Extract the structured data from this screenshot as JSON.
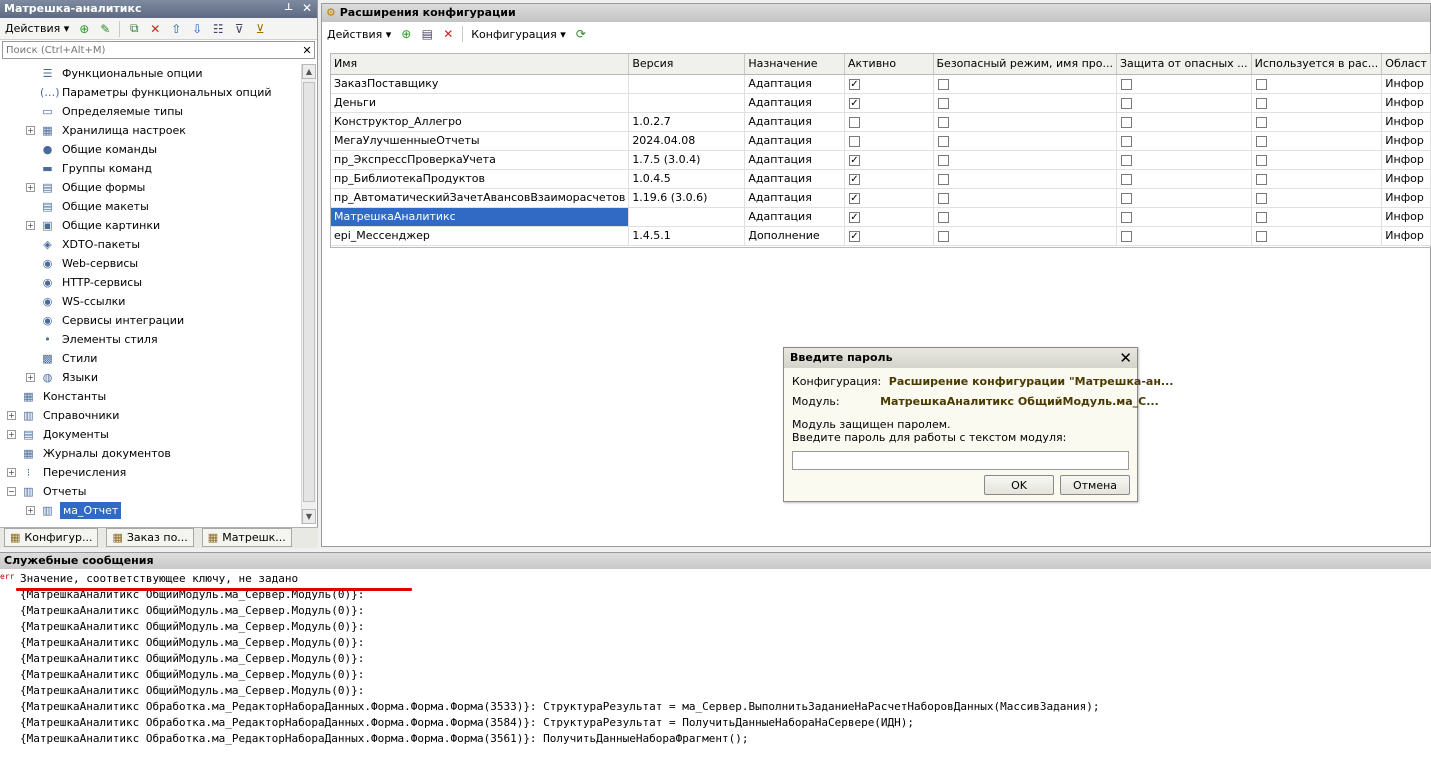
{
  "left_panel": {
    "title": "Матрешка-аналитикс",
    "actions_label": "Действия",
    "search_placeholder": "Поиск (Ctrl+Alt+M)",
    "tree": [
      {
        "label": "Функциональные опции",
        "indent": 2,
        "expander": false,
        "icon": "functional-options-icon",
        "glyph": "☰"
      },
      {
        "label": "Параметры функциональных опций",
        "indent": 2,
        "expander": false,
        "icon": "fo-params-icon",
        "glyph": "(…)"
      },
      {
        "label": "Определяемые типы",
        "indent": 2,
        "expander": false,
        "icon": "defined-types-icon",
        "glyph": "▭"
      },
      {
        "label": "Хранилища настроек",
        "indent": 2,
        "expander": true,
        "icon": "settings-storage-icon",
        "glyph": "▦"
      },
      {
        "label": "Общие команды",
        "indent": 2,
        "expander": false,
        "icon": "common-commands-icon",
        "glyph": "●"
      },
      {
        "label": "Группы команд",
        "indent": 2,
        "expander": false,
        "icon": "command-groups-icon",
        "glyph": "▬"
      },
      {
        "label": "Общие формы",
        "indent": 2,
        "expander": true,
        "icon": "common-forms-icon",
        "glyph": "▤"
      },
      {
        "label": "Общие макеты",
        "indent": 2,
        "expander": false,
        "icon": "common-templates-icon",
        "glyph": "▤"
      },
      {
        "label": "Общие картинки",
        "indent": 2,
        "expander": true,
        "icon": "common-pictures-icon",
        "glyph": "▣"
      },
      {
        "label": "XDTO-пакеты",
        "indent": 2,
        "expander": false,
        "icon": "xdto-icon",
        "glyph": "◈"
      },
      {
        "label": "Web-сервисы",
        "indent": 2,
        "expander": false,
        "icon": "web-services-icon",
        "glyph": "◉"
      },
      {
        "label": "HTTP-сервисы",
        "indent": 2,
        "expander": false,
        "icon": "http-services-icon",
        "glyph": "◉"
      },
      {
        "label": "WS-ссылки",
        "indent": 2,
        "expander": false,
        "icon": "ws-links-icon",
        "glyph": "◉"
      },
      {
        "label": "Сервисы интеграции",
        "indent": 2,
        "expander": false,
        "icon": "integration-services-icon",
        "glyph": "◉"
      },
      {
        "label": "Элементы стиля",
        "indent": 2,
        "expander": false,
        "icon": "style-elements-icon",
        "glyph": "•"
      },
      {
        "label": "Стили",
        "indent": 2,
        "expander": false,
        "icon": "styles-icon",
        "glyph": "▩"
      },
      {
        "label": "Языки",
        "indent": 2,
        "expander": true,
        "icon": "languages-icon",
        "glyph": "◍"
      },
      {
        "label": "Константы",
        "indent": 1,
        "expander": false,
        "icon": "constants-icon",
        "glyph": "▦"
      },
      {
        "label": "Справочники",
        "indent": 1,
        "expander": true,
        "icon": "catalogs-icon",
        "glyph": "▥"
      },
      {
        "label": "Документы",
        "indent": 1,
        "expander": true,
        "icon": "documents-icon",
        "glyph": "▤"
      },
      {
        "label": "Журналы документов",
        "indent": 1,
        "expander": false,
        "icon": "document-journals-icon",
        "glyph": "▦"
      },
      {
        "label": "Перечисления",
        "indent": 1,
        "expander": true,
        "icon": "enums-icon",
        "glyph": "⁝"
      },
      {
        "label": "Отчеты",
        "indent": 1,
        "expander": true,
        "expanded": true,
        "icon": "reports-icon",
        "glyph": "▥"
      },
      {
        "label": "ма_Отчет",
        "indent": 2,
        "expander": true,
        "icon": "report-icon",
        "glyph": "▥",
        "selected": true
      }
    ],
    "bottom_tabs": [
      "Конфигур...",
      "Заказ по...",
      "Матрешк..."
    ]
  },
  "right_panel": {
    "title": "Расширения конфигурации",
    "actions_label": "Действия",
    "config_label": "Конфигурация",
    "columns": [
      "Имя",
      "Версия",
      "Назначение",
      "Активно",
      "Безопасный режим, имя про...",
      "Защита от опасных ...",
      "Используется в рас...",
      "Област"
    ],
    "rows": [
      {
        "name": "ЗаказПоставщику",
        "version": "",
        "purpose": "Адаптация",
        "active": true,
        "scope": "Инфор"
      },
      {
        "name": "Деньги",
        "version": "",
        "purpose": "Адаптация",
        "active": true,
        "scope": "Инфор"
      },
      {
        "name": "Конструктор_Аллегро",
        "version": "1.0.2.7",
        "purpose": "Адаптация",
        "active": false,
        "scope": "Инфор"
      },
      {
        "name": "МегаУлучшенныеОтчеты",
        "version": "2024.04.08",
        "purpose": "Адаптация",
        "active": false,
        "scope": "Инфор"
      },
      {
        "name": "пр_ЭкспрессПроверкаУчета",
        "version": "1.7.5 (3.0.4)",
        "purpose": "Адаптация",
        "active": true,
        "scope": "Инфор"
      },
      {
        "name": "пр_БиблиотекаПродуктов",
        "version": "1.0.4.5",
        "purpose": "Адаптация",
        "active": true,
        "scope": "Инфор"
      },
      {
        "name": "пр_АвтоматическийЗачетАвансовВзаиморасчетов",
        "version": "1.19.6 (3.0.6)",
        "purpose": "Адаптация",
        "active": true,
        "scope": "Инфор"
      },
      {
        "name": "МатрешкаАналитикс",
        "version": "",
        "purpose": "Адаптация",
        "active": true,
        "scope": "Инфор",
        "selected": true
      },
      {
        "name": "epi_Мессенджер",
        "version": "1.4.5.1",
        "purpose": "Дополнение",
        "active": true,
        "scope": "Инфор"
      }
    ]
  },
  "dialog": {
    "title": "Введите пароль",
    "config_label": "Конфигурация:",
    "config_value": "Расширение конфигурации \"Матрешка-ан...",
    "module_label": "Модуль:",
    "module_value": "МатрешкаАналитикс ОбщийМодуль.ма_С...",
    "message_line1": "Модуль защищен паролем.",
    "message_line2": "Введите пароль для работы с текстом модуля:",
    "password_value": "",
    "ok_label": "OK",
    "cancel_label": "Отмена"
  },
  "messages": {
    "title": "Служебные сообщения",
    "error_prefix": "err",
    "lines": [
      "Значение, соответствующее ключу, не задано",
      "{МатрешкаАналитикс ОбщийМодуль.ма_Сервер.Модуль(0)}:",
      "{МатрешкаАналитикс ОбщийМодуль.ма_Сервер.Модуль(0)}:",
      "{МатрешкаАналитикс ОбщийМодуль.ма_Сервер.Модуль(0)}:",
      "{МатрешкаАналитикс ОбщийМодуль.ма_Сервер.Модуль(0)}:",
      "{МатрешкаАналитикс ОбщийМодуль.ма_Сервер.Модуль(0)}:",
      "{МатрешкаАналитикс ОбщийМодуль.ма_Сервер.Модуль(0)}:",
      "{МатрешкаАналитикс ОбщийМодуль.ма_Сервер.Модуль(0)}:",
      "{МатрешкаАналитикс Обработка.ма_РедакторНабораДанных.Форма.Форма.Форма(3533)}:  СтруктураРезультат = ма_Сервер.ВыполнитьЗаданиеНаРасчетНаборовДанных(МассивЗадания);",
      "{МатрешкаАналитикс Обработка.ма_РедакторНабораДанных.Форма.Форма.Форма(3584)}:  СтруктураРезультат = ПолучитьДанныеНабораНаСервере(ИДН);",
      "{МатрешкаАналитикс Обработка.ма_РедакторНабораДанных.Форма.Форма.Форма(3561)}:  ПолучитьДанныеНабораФрагмент();"
    ]
  }
}
